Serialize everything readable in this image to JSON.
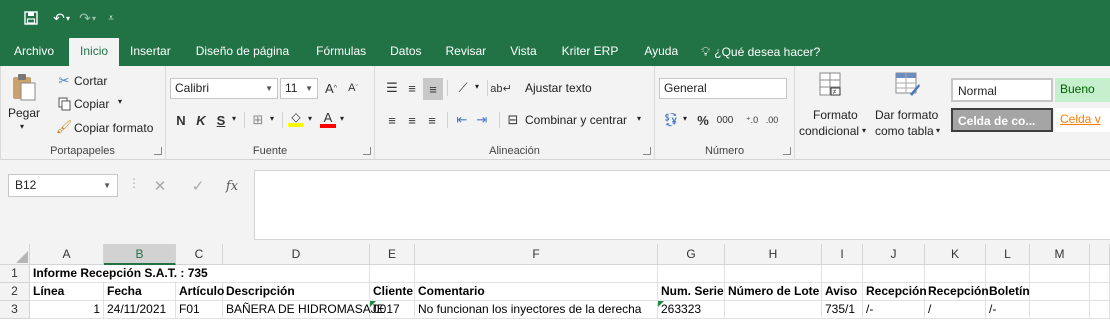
{
  "quick_access": {
    "save_icon": "save-icon",
    "undo_icon": "undo-icon",
    "redo_icon": "redo-icon",
    "customize_icon": "customize-qat-icon"
  },
  "tabs": [
    "Archivo",
    "Inicio",
    "Insertar",
    "Diseño de página",
    "Fórmulas",
    "Datos",
    "Revisar",
    "Vista",
    "Kriter ERP",
    "Ayuda"
  ],
  "tell_me": "¿Qué desea hacer?",
  "clipboard": {
    "paste": "Pegar",
    "cut": "Cortar",
    "copy": "Copiar",
    "format_painter": "Copiar formato",
    "label": "Portapapeles"
  },
  "font": {
    "name": "Calibri",
    "size": "11",
    "bold": "N",
    "italic": "K",
    "underline": "S",
    "label": "Fuente"
  },
  "alignment": {
    "wrap": "Ajustar texto",
    "merge": "Combinar y centrar",
    "label": "Alineación"
  },
  "number": {
    "format": "General",
    "percent": "%",
    "thousands": "000",
    "label": "Número"
  },
  "styles": {
    "conditional_1": "Formato",
    "conditional_2": "condicional",
    "table_1": "Dar formato",
    "table_2": "como tabla",
    "normal": "Normal",
    "good": "Bueno",
    "check_cell": "Celda de co...",
    "linked_cell": "Celda v"
  },
  "formula_bar": {
    "name_box": "B12",
    "fx": "fx",
    "value": ""
  },
  "columns": [
    "A",
    "B",
    "C",
    "D",
    "E",
    "F",
    "G",
    "H",
    "I",
    "J",
    "K",
    "L",
    "M"
  ],
  "rows": {
    "r1": {
      "num": "1",
      "A": "Informe Recepción S.A.T. : 735"
    },
    "r2": {
      "num": "2",
      "A": "Línea",
      "B": "Fecha",
      "C": "Artículo",
      "D": "Descripción",
      "E": "Cliente",
      "F": "Comentario",
      "G": "Num. Serie",
      "H": "Número de Lote",
      "I": "Aviso",
      "J": "Recepción",
      "K": "Recepción",
      "L": "Boletín"
    },
    "r3": {
      "num": "3",
      "A": "1",
      "B": "24/11/2021",
      "C": "F01",
      "D": "BAÑERA DE HIDROMASAJE",
      "E": "0017",
      "F": "No funcionan los inyectores de la derecha",
      "G": "263323",
      "H": "",
      "I": "735/1",
      "J": "/-",
      "K": "/",
      "L": "/-"
    }
  },
  "colors": {
    "accent": "#217346",
    "ribbon": "#f3f3f3",
    "font_highlight": "#ffff00",
    "font_color": "#ff0000"
  }
}
